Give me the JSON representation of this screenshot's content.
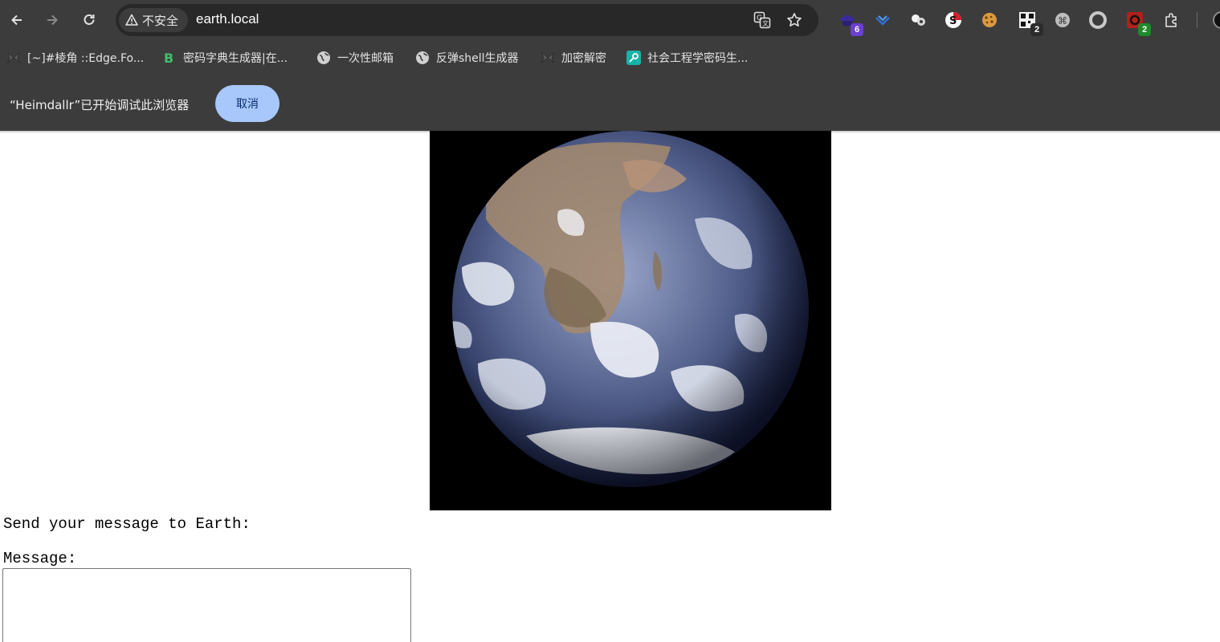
{
  "browser": {
    "security_label": "不安全",
    "url": "earth.local",
    "extensions": [
      {
        "name": "hat-extension-icon",
        "badge": "6",
        "badge_color": "#6b3fd1"
      },
      {
        "name": "wappalyzer-icon",
        "badge": ""
      },
      {
        "name": "cookie-extension-icon",
        "badge": ""
      },
      {
        "name": "s-extension-icon",
        "badge": ""
      },
      {
        "name": "cookie-icon",
        "badge": ""
      },
      {
        "name": "qr-extension-icon",
        "badge": "2",
        "badge_color": "#2b2b2b"
      },
      {
        "name": "shortcut-extension-icon",
        "badge": ""
      },
      {
        "name": "circle-extension-icon",
        "badge": ""
      },
      {
        "name": "red-extension-icon",
        "badge": "2",
        "badge_color": "#1f8a2b"
      },
      {
        "name": "puzzle-icon",
        "badge": ""
      }
    ]
  },
  "bookmarks": [
    {
      "label": "[~]#棱角 ::Edge.Fo...",
      "icon": "moth-icon"
    },
    {
      "label": "密码字典生成器|在...",
      "icon": "b-logo-icon"
    },
    {
      "label": "一次性邮箱",
      "icon": "globe-icon"
    },
    {
      "label": "反弹shell生成器",
      "icon": "globe-icon"
    },
    {
      "label": "加密解密",
      "icon": "moth-icon"
    },
    {
      "label": "社会工程学密码生...",
      "icon": "key-icon"
    }
  ],
  "infobar": {
    "text": "“Heimdallr”已开始调试此浏览器",
    "cancel_label": "取消"
  },
  "page": {
    "heading": "Send your message to Earth:",
    "message_label": "Message:",
    "message_value": ""
  },
  "colors": {
    "chrome_bg": "#3c3c3c",
    "omnibox_bg": "#282828",
    "cancel_bg": "#a8c7fa"
  }
}
